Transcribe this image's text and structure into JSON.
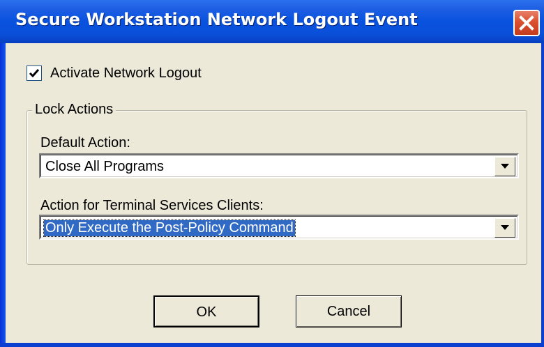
{
  "window": {
    "title": "Secure Workstation Network Logout Event"
  },
  "activate": {
    "label": "Activate Network Logout",
    "checked": true
  },
  "lock_actions": {
    "group_label": "Lock Actions",
    "default_action": {
      "label": "Default Action:",
      "value": "Close All Programs"
    },
    "terminal_services": {
      "label": "Action for Terminal Services Clients:",
      "value": "Only Execute the Post-Policy Command"
    }
  },
  "buttons": {
    "ok": "OK",
    "cancel": "Cancel"
  },
  "colors": {
    "titlebar": "#0852DE",
    "dialog_bg": "#ECE9D8",
    "selection": "#316AC5",
    "close_button": "#D9502F"
  },
  "icons": {
    "close": "close-icon",
    "check": "checkmark-icon",
    "dropdown": "chevron-down-icon"
  }
}
